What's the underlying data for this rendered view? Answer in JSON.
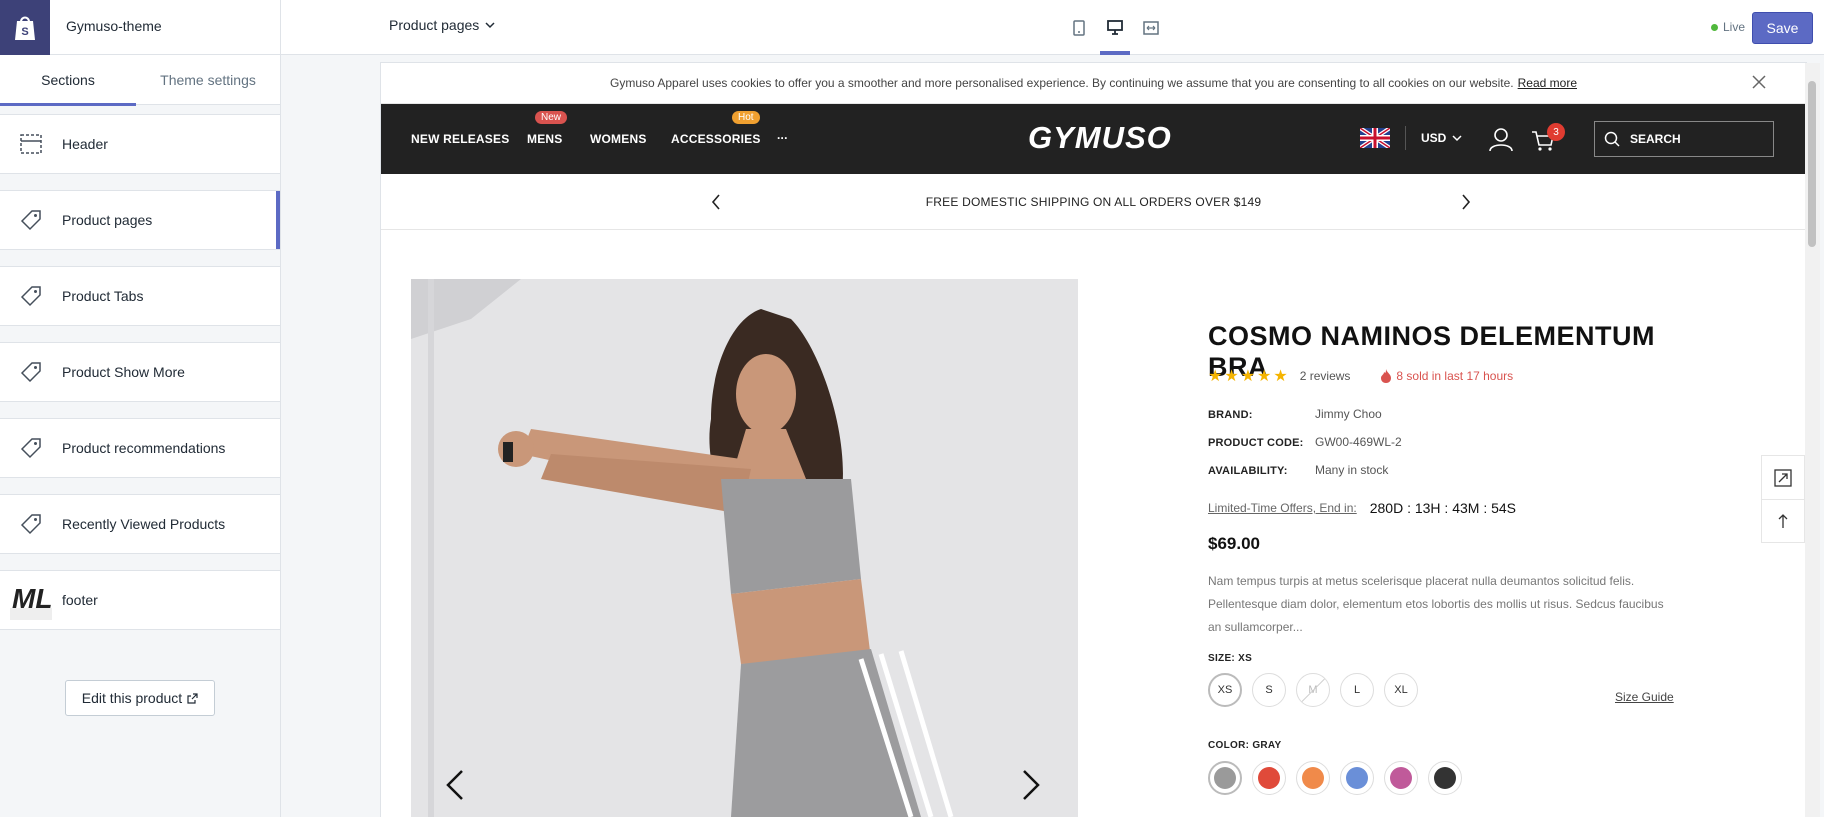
{
  "app": {
    "theme_name": "Gymuso-theme",
    "live_label": "Live",
    "save_label": "Save",
    "page_selector": "Product pages"
  },
  "device_icons": [
    "mobile-icon",
    "desktop-icon",
    "fullscreen-icon"
  ],
  "sidebar": {
    "tabs": [
      {
        "label": "Sections",
        "active": true
      },
      {
        "label": "Theme settings",
        "active": false
      }
    ],
    "items": [
      {
        "label": "Header",
        "icon": "header-layout-icon"
      },
      {
        "label": "Product pages",
        "icon": "tag-icon",
        "selected": true
      },
      {
        "label": "Product Tabs",
        "icon": "tag-icon"
      },
      {
        "label": "Product Show More",
        "icon": "tag-icon"
      },
      {
        "label": "Product recommendations",
        "icon": "tag-icon"
      },
      {
        "label": "Recently Viewed Products",
        "icon": "tag-icon"
      },
      {
        "label": "footer",
        "icon": "ml-logo-thumb"
      }
    ],
    "edit_button": "Edit this product"
  },
  "store": {
    "cookie_text": "Gymuso Apparel uses cookies to offer you a smoother and more personalised experience. By continuing we assume that you are consenting to all cookies on our website.",
    "cookie_link": "Read more",
    "nav": [
      {
        "label": "NEW RELEASES"
      },
      {
        "label": "MENS",
        "badge": "New"
      },
      {
        "label": "WOMENS"
      },
      {
        "label": "ACCESSORIES",
        "badge": "Hot"
      },
      {
        "label": "..."
      }
    ],
    "brand": "GYMUSO",
    "currency": "USD",
    "cart_count": "3",
    "search_placeholder": "SEARCH",
    "promo": "FREE DOMESTIC SHIPPING ON ALL ORDERS OVER $149"
  },
  "product": {
    "title": "COSMO NAMINOS DELEMENTUM BRA",
    "rating": 5,
    "reviews": "2 reviews",
    "sold": "8 sold in last 17 hours",
    "specs": [
      {
        "key": "BRAND:",
        "value": "Jimmy Choo"
      },
      {
        "key": "PRODUCT CODE:",
        "value": "GW00-469WL-2"
      },
      {
        "key": "AVAILABILITY:",
        "value": "Many in stock"
      }
    ],
    "offer_label": "Limited-Time Offers, End in:",
    "offer_timer": "280D : 13H : 43M : 54S",
    "price": "$69.00",
    "description": "Nam tempus turpis at metus scelerisque placerat nulla deumantos solicitud felis. Pellentesque diam dolor, elementum etos lobortis des mollis ut risus. Sedcus faucibus an sullamcorper...",
    "size_label": "SIZE: XS",
    "sizes": [
      {
        "label": "XS",
        "state": "selected"
      },
      {
        "label": "S",
        "state": "available"
      },
      {
        "label": "M",
        "state": "unavailable"
      },
      {
        "label": "L",
        "state": "available"
      },
      {
        "label": "XL",
        "state": "available"
      }
    ],
    "size_guide": "Size Guide",
    "color_label": "COLOR: GRAY",
    "colors": [
      "#9a9a9a",
      "#e04a3a",
      "#f08a4a",
      "#6a8fd8",
      "#c05a9a",
      "#333333"
    ]
  }
}
